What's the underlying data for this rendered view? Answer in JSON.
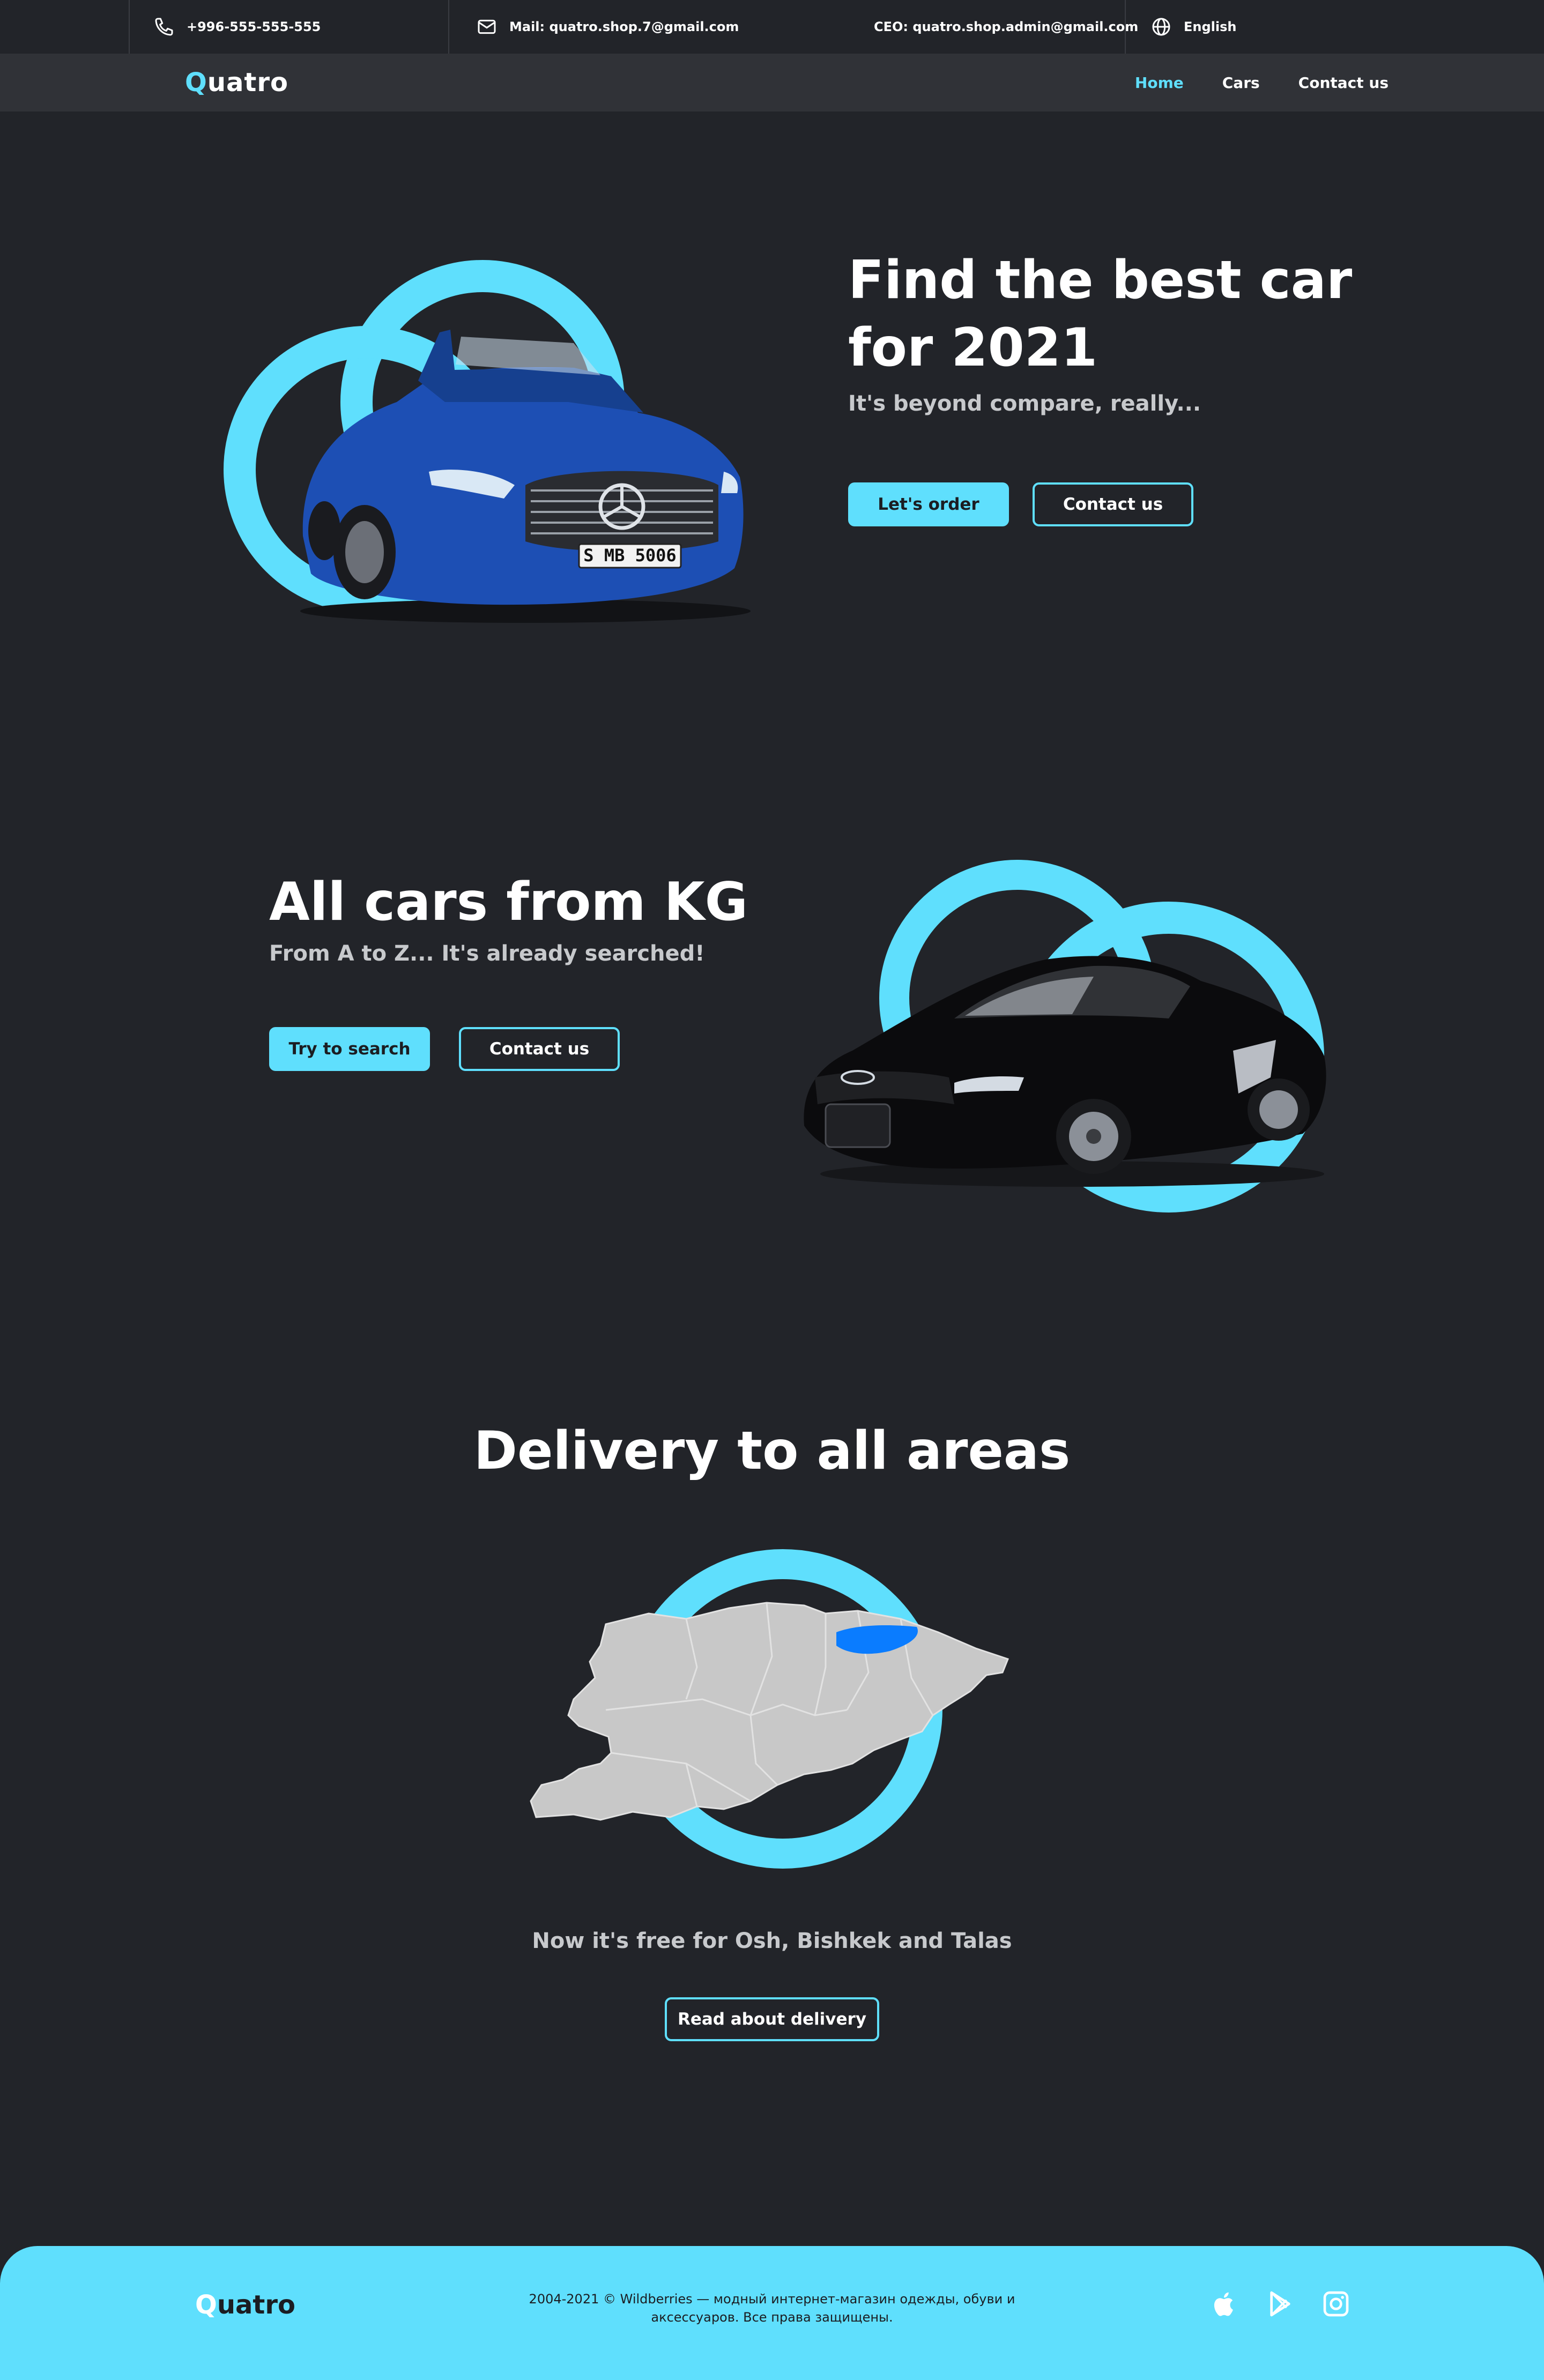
{
  "topbar": {
    "phone": "+996-555-555-555",
    "mail": "Mail: quatro.shop.7@gmail.com",
    "ceo": "CEO: quatro.shop.admin@gmail.com",
    "language": "English"
  },
  "nav": {
    "logo_q": "Q",
    "logo_rest": "uatro",
    "links": [
      "Home",
      "Cars",
      "Contact us"
    ]
  },
  "hero": {
    "title_line1": "Find the best car",
    "title_line2": "for 2021",
    "subtitle": "It's beyond compare, really...",
    "primary_button": "Let's order",
    "secondary_button": "Contact us",
    "plate": "S MB 5006"
  },
  "cars_section": {
    "title": "All cars from KG",
    "subtitle": "From A to Z... It's already searched!",
    "primary_button": "Try to search",
    "secondary_button": "Contact us"
  },
  "delivery": {
    "title": "Delivery to all areas",
    "subtitle": "Now it's free for Osh, Bishkek and Talas",
    "button": "Read about delivery"
  },
  "footer": {
    "logo_q": "Q",
    "logo_rest": "uatro",
    "copyright": "2004-2021 © Wildberries — модный интернет-магазин одежды, обуви и аксессуаров. Все права защищены.",
    "social_icons": [
      "apple-icon",
      "google-play-icon",
      "instagram-icon"
    ]
  },
  "colors": {
    "accent": "#5fdffd",
    "background": "#222429",
    "nav_background": "#303237",
    "map_highlight": "#0a7cff"
  }
}
